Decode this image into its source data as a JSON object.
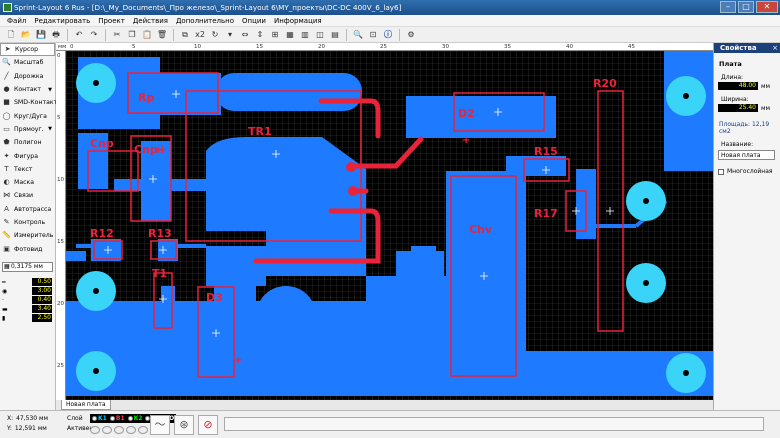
{
  "window": {
    "title": "Sprint-Layout 6 Rus - [D:\\_My_Documents\\_Про железо\\_Sprint-Layout 6\\MY_проекты\\DC-DC 400V_6_lay6]",
    "minimize": "–",
    "maximize": "□",
    "close": "✕"
  },
  "menu": [
    "Файл",
    "Редактировать",
    "Проект",
    "Действия",
    "Дополнительно",
    "Опции",
    "Информация"
  ],
  "toolbar": {
    "zoom_label": "x2"
  },
  "tools": [
    {
      "label": "Курсор",
      "icon": "cursor-icon",
      "glyph": "➤",
      "selected": true,
      "arrow": false
    },
    {
      "label": "Масштаб",
      "icon": "zoom-icon",
      "glyph": "🔍",
      "selected": false,
      "arrow": false
    },
    {
      "label": "Дорожка",
      "icon": "track-icon",
      "glyph": "╱",
      "selected": false,
      "arrow": false
    },
    {
      "label": "Контакт",
      "icon": "pad-icon",
      "glyph": "●",
      "selected": false,
      "arrow": true
    },
    {
      "label": "SMD-Контакт",
      "icon": "smd-pad-icon",
      "glyph": "■",
      "selected": false,
      "arrow": false
    },
    {
      "label": "Круг/Дуга",
      "icon": "circle-icon",
      "glyph": "◯",
      "selected": false,
      "arrow": false
    },
    {
      "label": "Прямоуг.",
      "icon": "rectangle-icon",
      "glyph": "▭",
      "selected": false,
      "arrow": true
    },
    {
      "label": "Полигон",
      "icon": "polygon-icon",
      "glyph": "⬟",
      "selected": false,
      "arrow": false
    },
    {
      "label": "Фигура",
      "icon": "figure-icon",
      "glyph": "✦",
      "selected": false,
      "arrow": false
    },
    {
      "label": "Текст",
      "icon": "text-icon",
      "glyph": "T",
      "selected": false,
      "arrow": false
    },
    {
      "label": "Маска",
      "icon": "mask-icon",
      "glyph": "◐",
      "selected": false,
      "arrow": false
    },
    {
      "label": "Связи",
      "icon": "connections-icon",
      "glyph": "⋈",
      "selected": false,
      "arrow": false
    },
    {
      "label": "Автотрасса",
      "icon": "autoroute-icon",
      "glyph": "A",
      "selected": false,
      "arrow": false
    },
    {
      "label": "Контроль",
      "icon": "check-icon",
      "glyph": "✎",
      "selected": false,
      "arrow": false
    },
    {
      "label": "Измеритель",
      "icon": "measure-icon",
      "glyph": "📏",
      "selected": false,
      "arrow": false
    },
    {
      "label": "Фотовид",
      "icon": "photoview-icon",
      "glyph": "▣",
      "selected": false,
      "arrow": false
    }
  ],
  "grid_value": "0,3175 мм",
  "track_width": "0.50",
  "pad_sizes": [
    "3.00",
    "0.40",
    "3.40",
    "2.50"
  ],
  "ruler_unit": "мм",
  "ruler_top": [
    "0",
    "5",
    "10",
    "15",
    "20",
    "25",
    "30",
    "35",
    "40",
    "45"
  ],
  "ruler_left": [
    "0",
    "5",
    "10",
    "15",
    "20",
    "25"
  ],
  "pcb": {
    "labels": [
      "Rp",
      "TR1",
      "D2",
      "R20",
      "Cnp",
      "Cnp+",
      "R15",
      "R17",
      "R12",
      "R13",
      "Chv",
      "T1",
      "D3"
    ],
    "colors": {
      "copper": "#1e7bff",
      "silk": "#e8233a",
      "pad": "#39d4f7",
      "board": "#000000",
      "grid": "#4a4a4a"
    }
  },
  "board_tab": "Новая плата",
  "properties": {
    "title": "Свойства",
    "close": "×",
    "section": "Плата",
    "length_label": "Длина:",
    "length_value": "48.00",
    "width_label": "Ширина:",
    "width_value": "25.40",
    "unit": "мм",
    "area": "Площадь: 12,19 см2",
    "name_label": "Название:",
    "name_value": "Новая плата",
    "multilayer": "Многослойная"
  },
  "status": {
    "x_label": "X:",
    "x_value": "47,530 мм",
    "y_label": "Y:",
    "y_value": "12,591 мм",
    "layer_label": "Слой",
    "active_label": "Активен",
    "layers": [
      {
        "name": "K1",
        "color": "#00cfff"
      },
      {
        "name": "B1",
        "color": "#ff3a3a"
      },
      {
        "name": "K2",
        "color": "#00e000"
      },
      {
        "name": "B2",
        "color": "#f0e000"
      },
      {
        "name": "O",
        "color": "#ffffff"
      }
    ]
  }
}
